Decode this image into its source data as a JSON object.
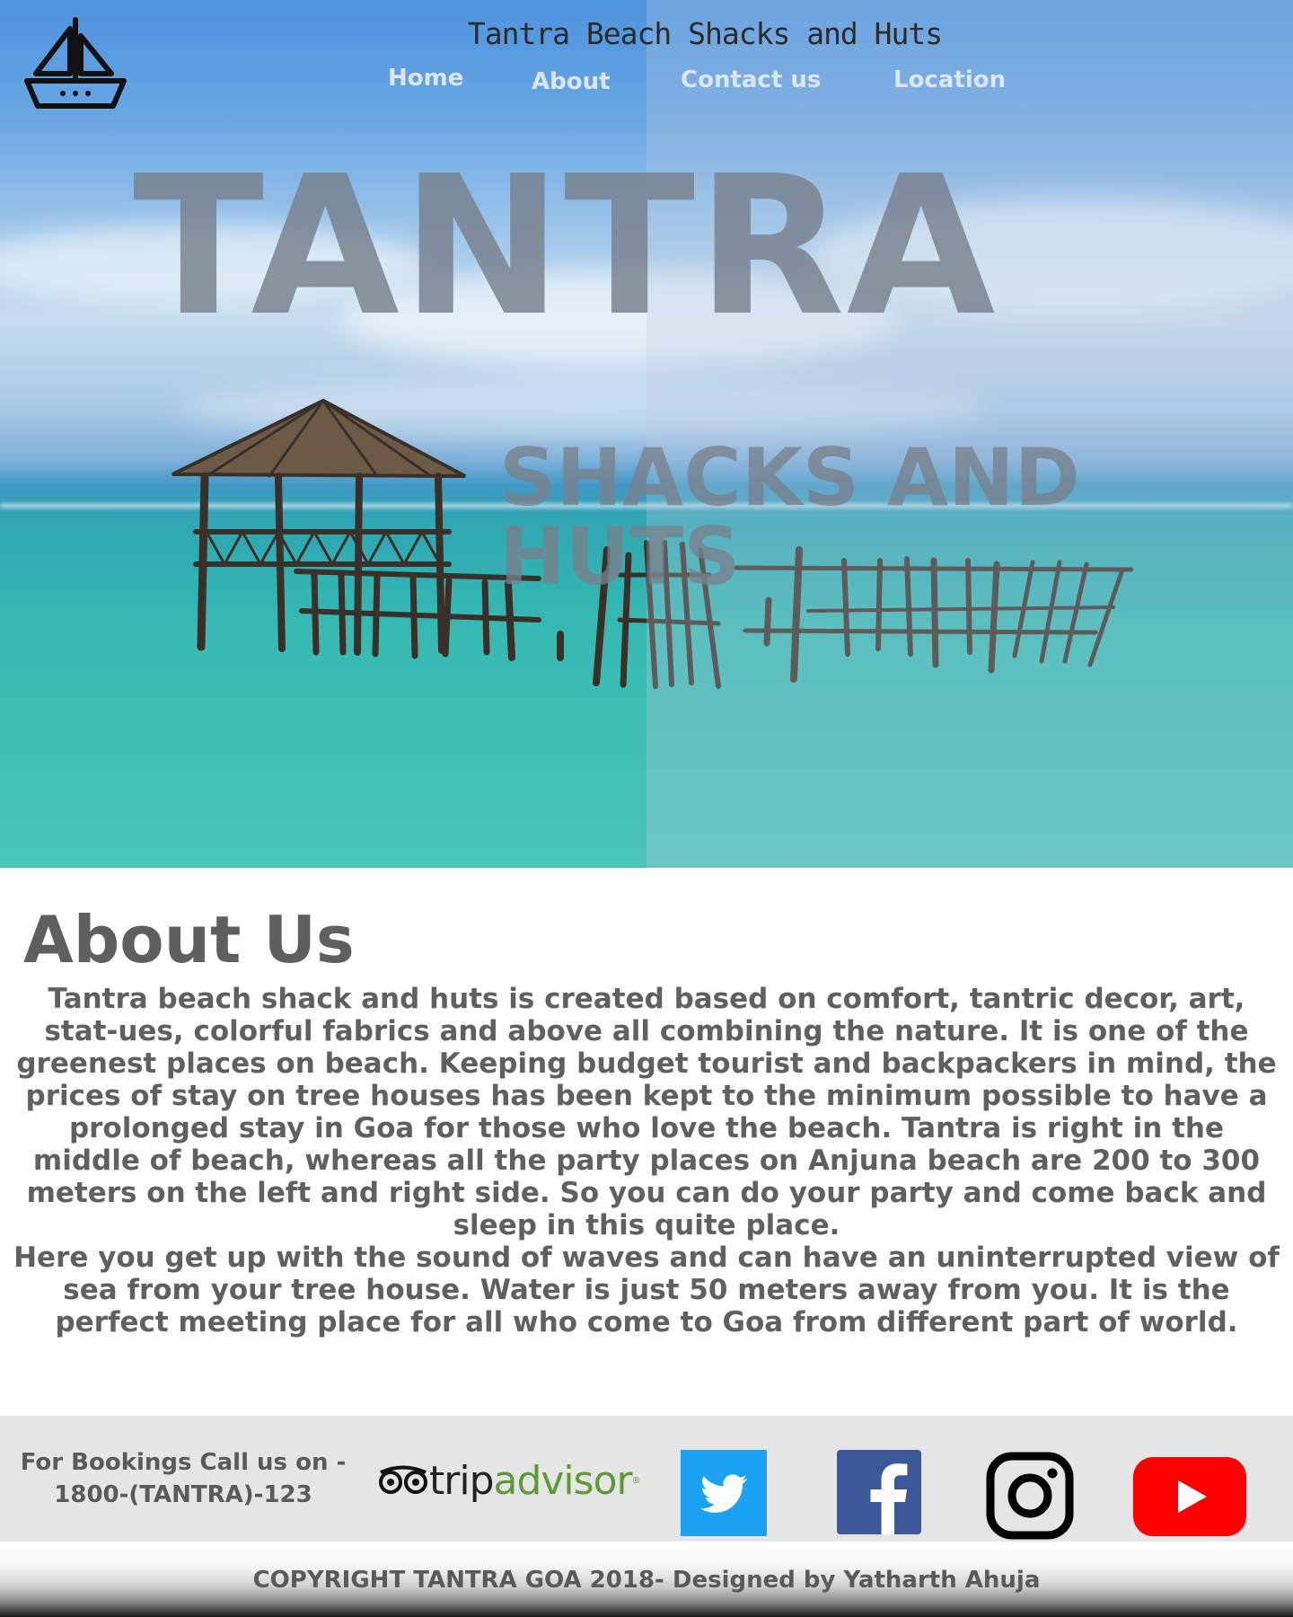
{
  "header": {
    "site_title": "Tantra Beach Shacks and Huts",
    "nav": [
      {
        "label": "Home"
      },
      {
        "label": "About"
      },
      {
        "label": "Contact us"
      },
      {
        "label": "Location"
      }
    ]
  },
  "hero": {
    "headline": "TANTRA",
    "subheadline": "SHACKS AND HUTS"
  },
  "about": {
    "title": "About Us",
    "paragraph_1": "Tantra beach shack and huts is created based on comfort, tantric decor, art, stat-ues, colorful fabrics and above all combining the nature. It is one of the greenest places on beach. Keeping budget tourist and backpackers in mind, the prices of stay on tree houses has been kept to the minimum possible to have a prolonged stay in Goa for those who love the beach. Tantra is right in the middle of beach, whereas all the party places on Anjuna beach are 200 to 300 meters on the left and right side. So you can do your party and come back and sleep in this quite place.",
    "paragraph_2": "Here you get up with the sound of waves and can have an uninterrupted view of sea from your tree house. Water is just 50 meters away from you. It is the perfect meeting place for all who come to Goa from different part of world."
  },
  "footer": {
    "booking_line_1": "For Bookings Call us on -",
    "booking_line_2": "1800-(TANTRA)-123",
    "tripadvisor": {
      "word_trip": "trip",
      "word_advisor": "advisor",
      "mark": "®"
    },
    "social_icons": [
      "twitter-icon",
      "facebook-icon",
      "instagram-icon",
      "youtube-icon"
    ],
    "brand_colors": {
      "twitter": "#1da1f2",
      "facebook": "#3b5998",
      "instagram": "#000000",
      "youtube": "#ff0000",
      "tripadvisor_green": "#5d9a36"
    }
  },
  "copyright": "COPYRIGHT TANTRA GOA 2018- Designed by Yatharth Ahuja"
}
